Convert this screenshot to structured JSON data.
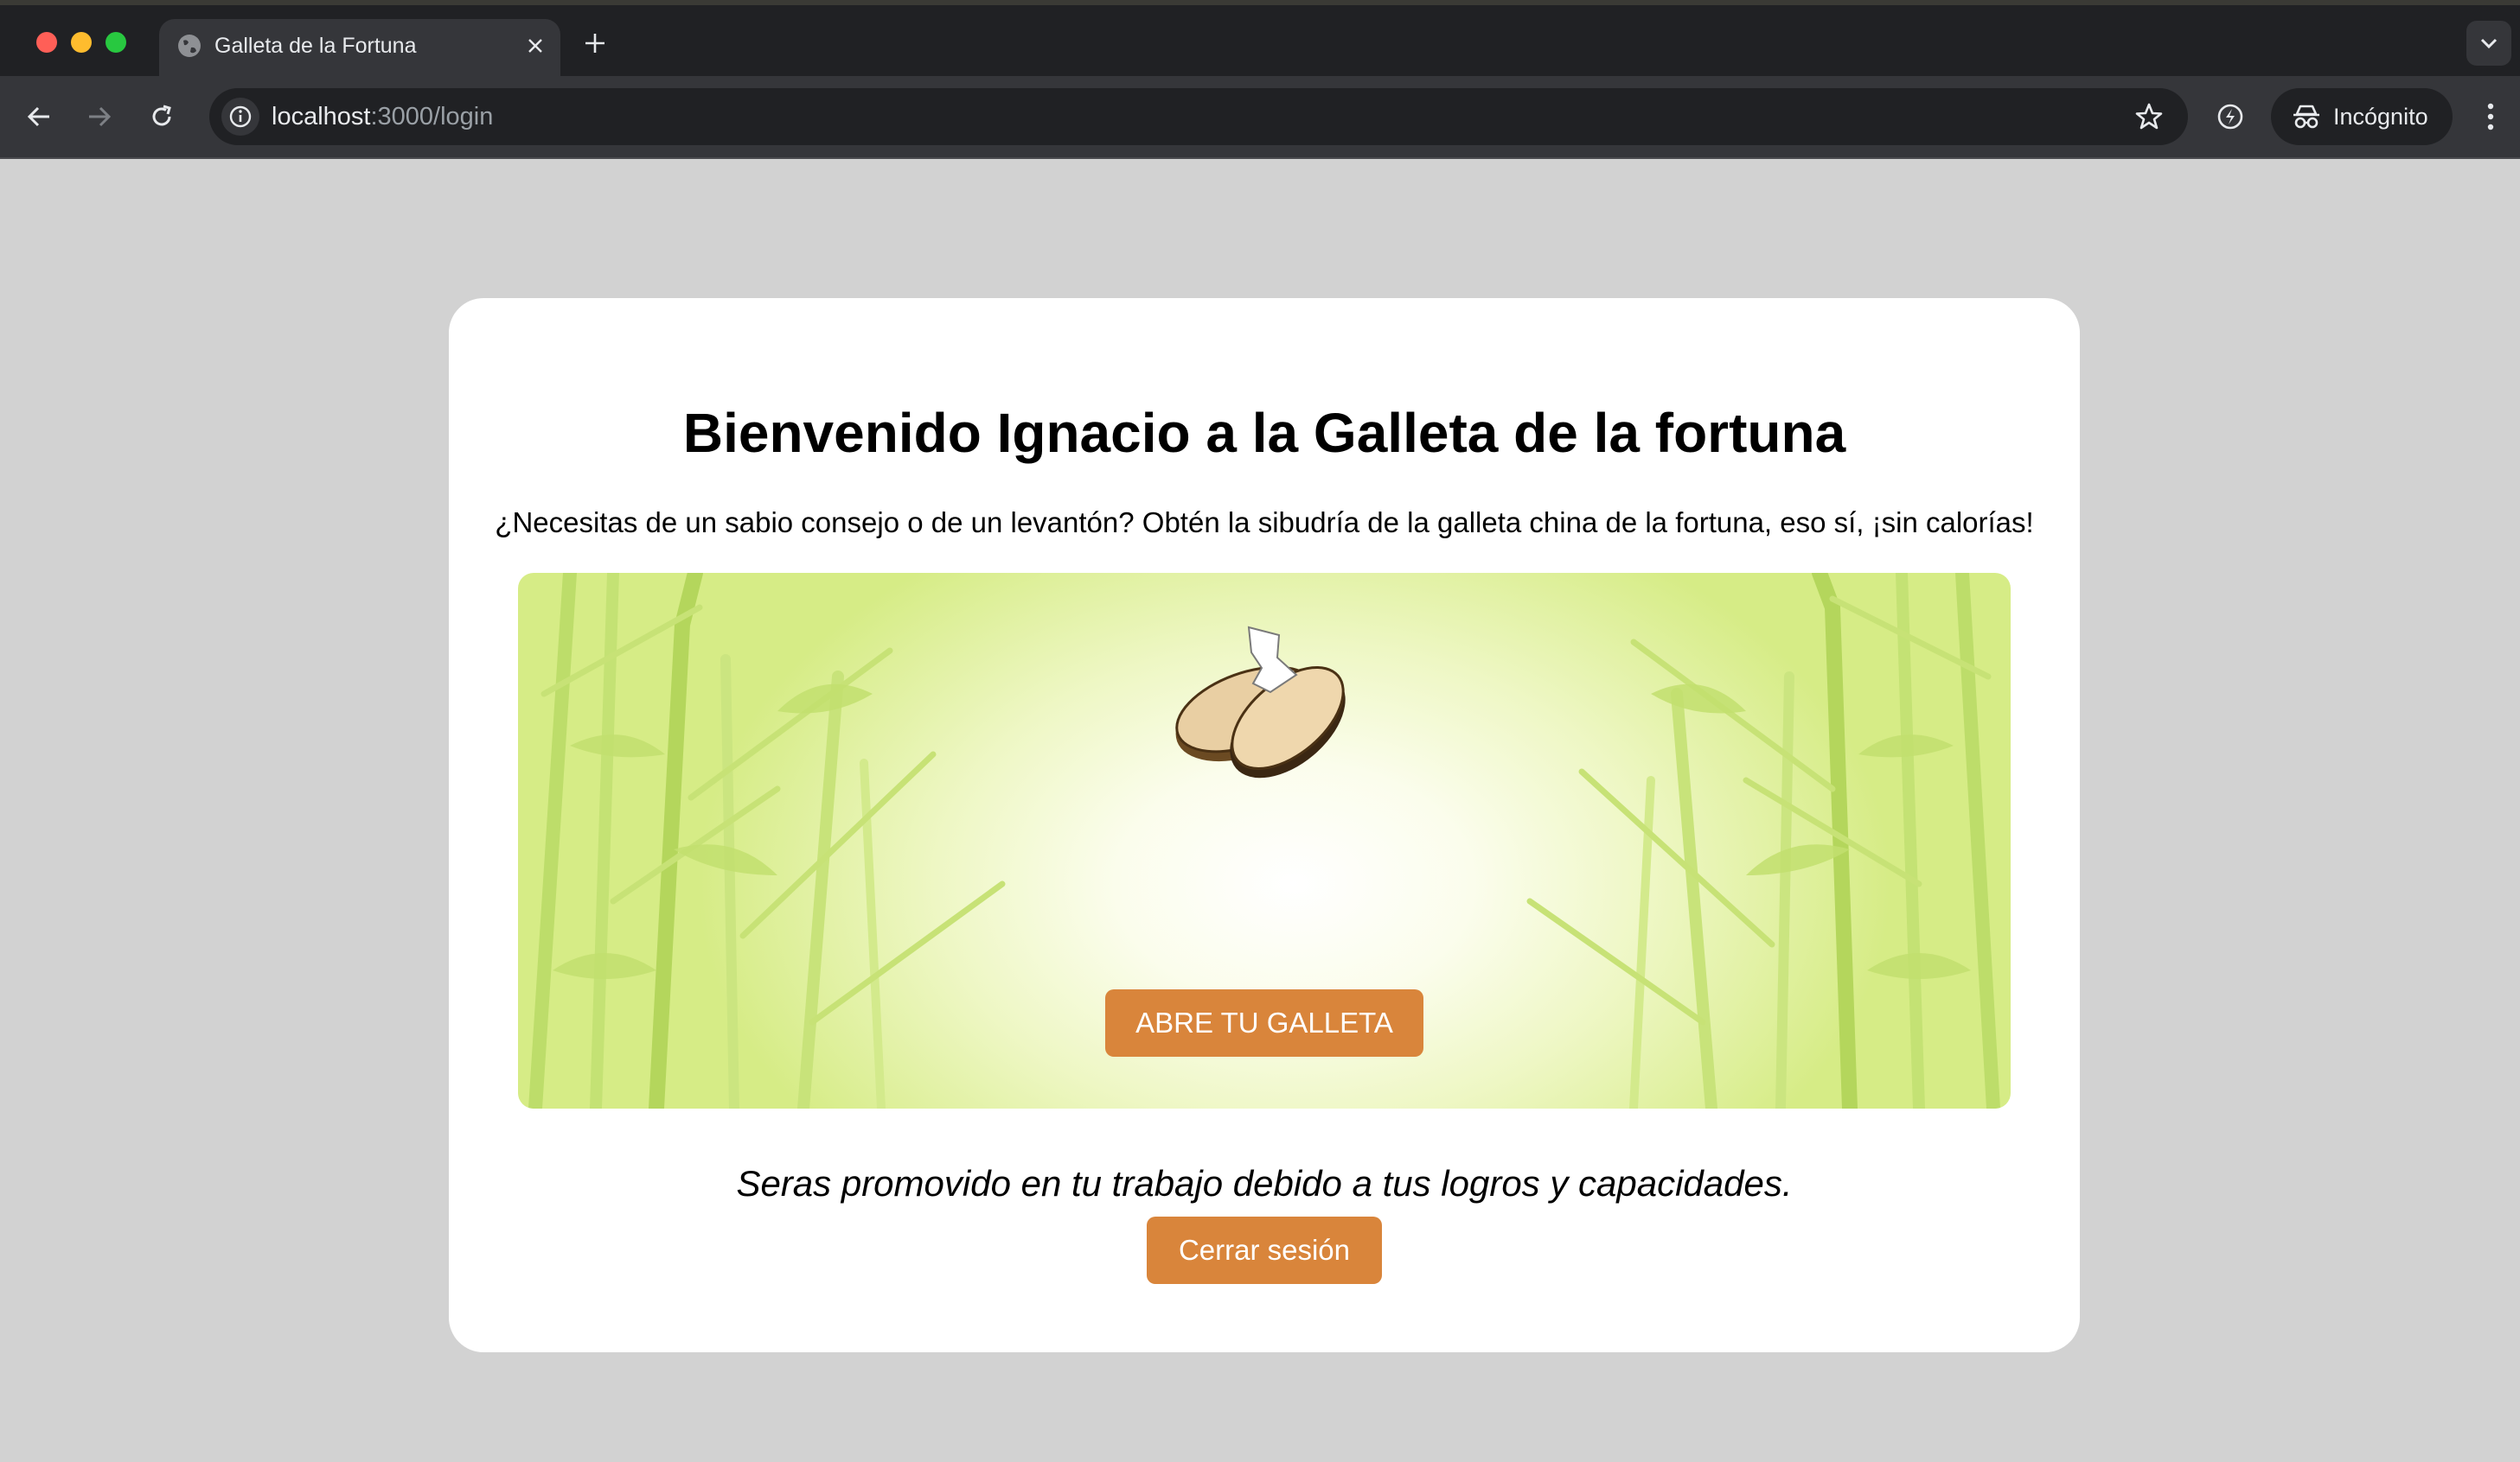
{
  "browser": {
    "tab_title": "Galleta de la Fortuna",
    "url_host": "localhost",
    "url_path": ":3000/login",
    "incognito_label": "Incógnito",
    "icons": [
      "globe-icon",
      "close-icon",
      "plus-icon",
      "chevron-down-icon",
      "back-arrow-icon",
      "forward-arrow-icon",
      "reload-icon",
      "info-icon",
      "star-icon",
      "extension-icon",
      "incognito-icon",
      "kebab-menu-icon"
    ]
  },
  "page": {
    "title": "Bienvenido Ignacio a la Galleta de la fortuna",
    "intro": "¿Necesitas de un sabio consejo o de un levantón? Obtén la sibudría de la galleta china de la fortuna, eso sí, ¡sin calorías!",
    "open_button_label": "ABRE TU GALLETA",
    "fortune_text": "Seras promovido en tu trabajo debido a tus logros y capacidades.",
    "logout_button_label": "Cerrar sesión"
  },
  "colors": {
    "background": "#d2d2d2",
    "card": "#ffffff",
    "accent_button": "#d9853b",
    "bamboo": "#b6d85a"
  }
}
